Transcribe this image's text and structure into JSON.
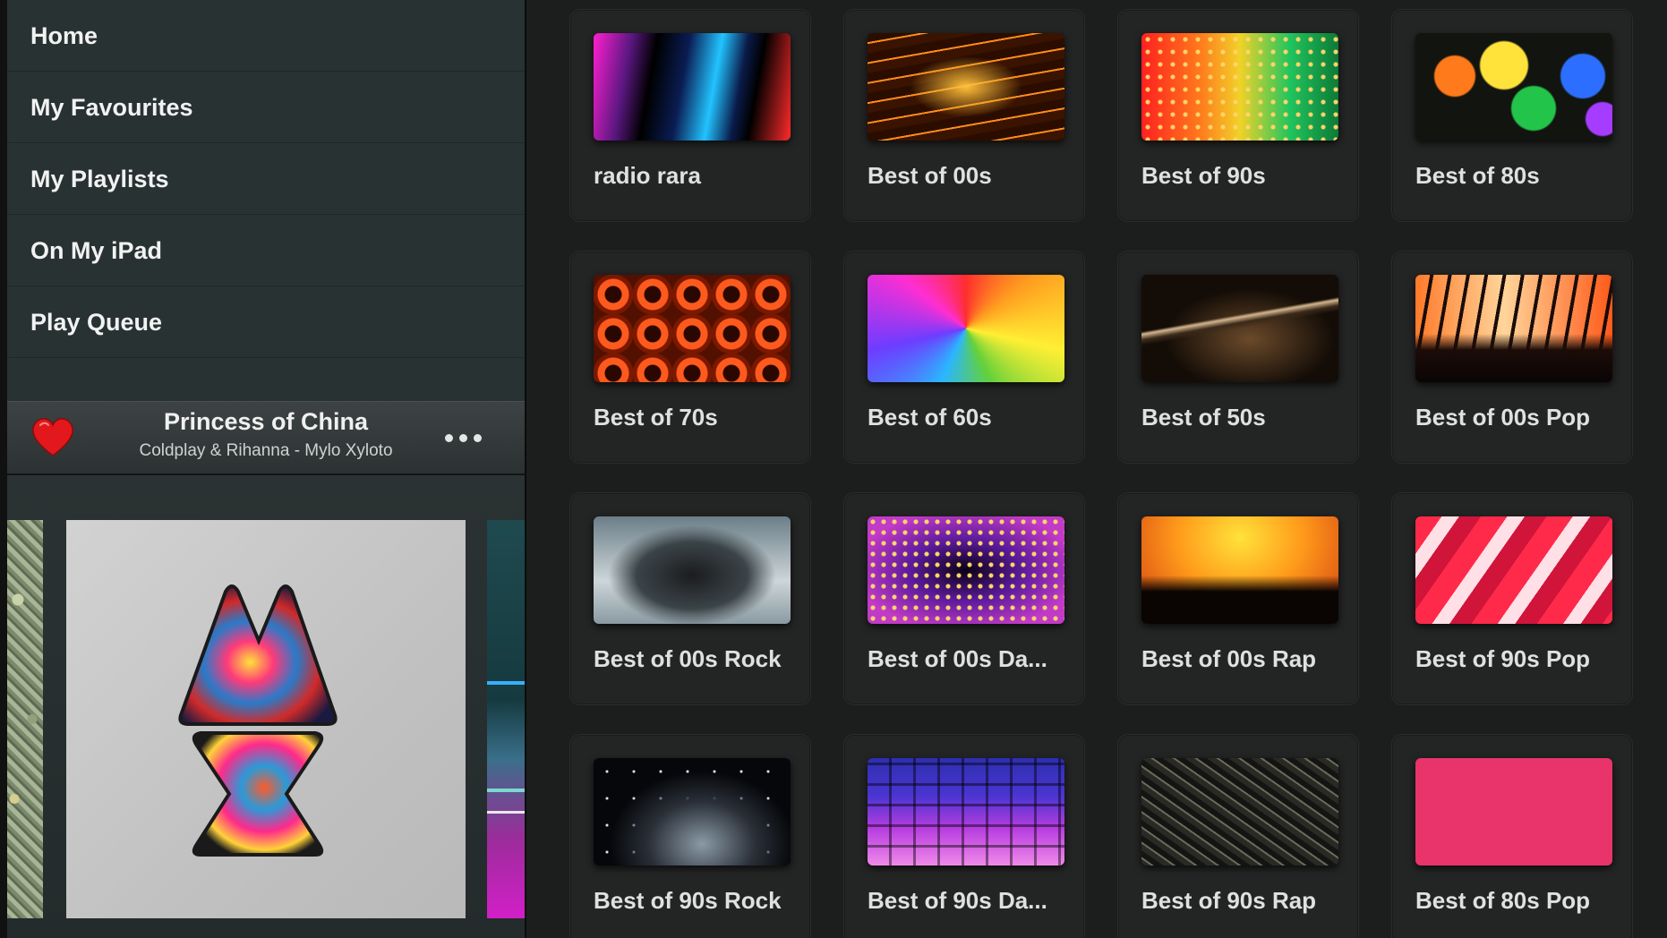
{
  "sidebar": {
    "nav_items": [
      {
        "label": "Home"
      },
      {
        "label": "My Favourites"
      },
      {
        "label": "My Playlists"
      },
      {
        "label": "On My iPad"
      },
      {
        "label": "Play Queue"
      }
    ]
  },
  "now_playing": {
    "title": "Princess of China",
    "subtitle": "Coldplay & Rihanna - Mylo Xyloto",
    "favourite": true,
    "heart_color": "#e2181c"
  },
  "stations": [
    {
      "label": "radio rara",
      "art": "t-radio"
    },
    {
      "label": "Best of 00s",
      "art": "t-00s"
    },
    {
      "label": "Best of 90s",
      "art": "t-90s"
    },
    {
      "label": "Best of 80s",
      "art": "t-80s"
    },
    {
      "label": "Best of 70s",
      "art": "t-70s"
    },
    {
      "label": "Best of 60s",
      "art": "t-60s"
    },
    {
      "label": "Best of 50s",
      "art": "t-50s"
    },
    {
      "label": "Best of 00s Pop",
      "art": "t-00pop"
    },
    {
      "label": "Best of 00s Rock",
      "art": "t-00rock"
    },
    {
      "label": "Best of 00s Da...",
      "art": "t-00dance"
    },
    {
      "label": "Best of 00s Rap",
      "art": "t-00rap"
    },
    {
      "label": "Best of 90s Pop",
      "art": "t-90pop"
    },
    {
      "label": "Best of 90s Rock",
      "art": "t-90rock"
    },
    {
      "label": "Best of 90s Da...",
      "art": "t-90dance"
    },
    {
      "label": "Best of 90s Rap",
      "art": "t-90rap"
    },
    {
      "label": "Best of 80s Pop",
      "art": "t-80pop"
    }
  ]
}
